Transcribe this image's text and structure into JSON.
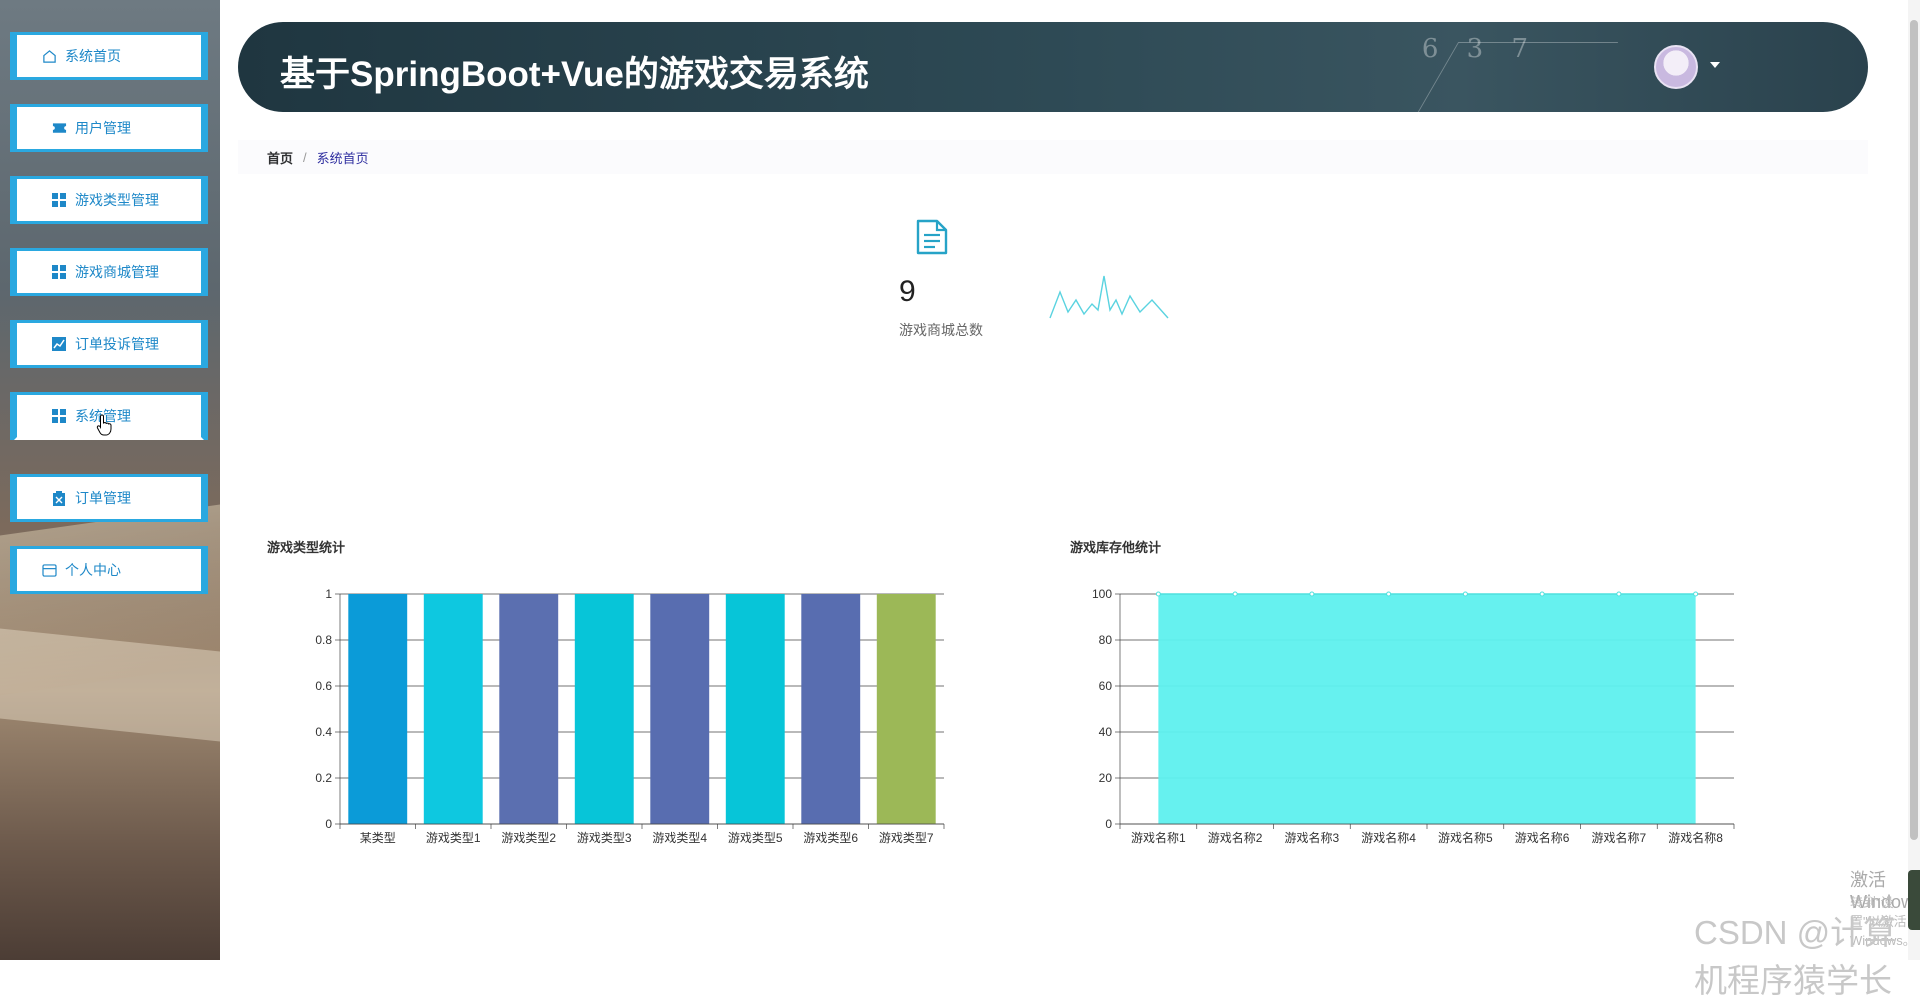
{
  "sidebar": {
    "items": [
      {
        "label": "系统首页",
        "icon": "home-icon"
      },
      {
        "label": "用户管理",
        "icon": "ticket-icon"
      },
      {
        "label": "游戏类型管理",
        "icon": "grid-icon"
      },
      {
        "label": "游戏商城管理",
        "icon": "grid-icon"
      },
      {
        "label": "订单投诉管理",
        "icon": "chart-icon"
      },
      {
        "label": "系统管理",
        "icon": "grid-icon"
      },
      {
        "label": "订单管理",
        "icon": "clipboard-icon"
      },
      {
        "label": "个人中心",
        "icon": "card-icon"
      }
    ]
  },
  "header": {
    "title": "基于SpringBoot+Vue的游戏交易系统",
    "deco_text": "6 3 7"
  },
  "breadcrumb": {
    "home": "首页",
    "separator": "/",
    "current": "系统首页"
  },
  "stat": {
    "value": "9",
    "label": "游戏商城总数",
    "icon": "document-icon",
    "accent": "#26a3c7"
  },
  "charts": {
    "left_title": "游戏类型统计",
    "right_title": "游戏库存他统计"
  },
  "chart_data": [
    {
      "type": "bar",
      "title": "游戏类型统计",
      "categories": [
        "某类型",
        "游戏类型1",
        "游戏类型2",
        "游戏类型3",
        "游戏类型4",
        "游戏类型5",
        "游戏类型6",
        "游戏类型7"
      ],
      "values": [
        1,
        1,
        1,
        1,
        1,
        1,
        1,
        1
      ],
      "colors": [
        "#0b9bd8",
        "#0ec8e0",
        "#5b6fb0",
        "#07c5d8",
        "#586db0",
        "#07c5d8",
        "#586db0",
        "#9cb857"
      ],
      "yticks": [
        "0",
        "0.2",
        "0.4",
        "0.6",
        "0.8",
        "1"
      ],
      "ylim": [
        0,
        1
      ],
      "grid": true
    },
    {
      "type": "area",
      "title": "游戏库存他统计",
      "categories": [
        "游戏名称1",
        "游戏名称2",
        "游戏名称3",
        "游戏名称4",
        "游戏名称5",
        "游戏名称6",
        "游戏名称7",
        "游戏名称8"
      ],
      "values": [
        100,
        100,
        100,
        100,
        100,
        100,
        100,
        100
      ],
      "color": "#5ef0ee",
      "yticks": [
        "0",
        "20",
        "40",
        "60",
        "80",
        "100"
      ],
      "ylim": [
        0,
        100
      ],
      "grid": true
    }
  ],
  "watermark": {
    "line1": "激活 Windows",
    "line2": "转到\"设置\"以激活 Windows。",
    "csdn": "CSDN @计算机程序猿学长"
  }
}
